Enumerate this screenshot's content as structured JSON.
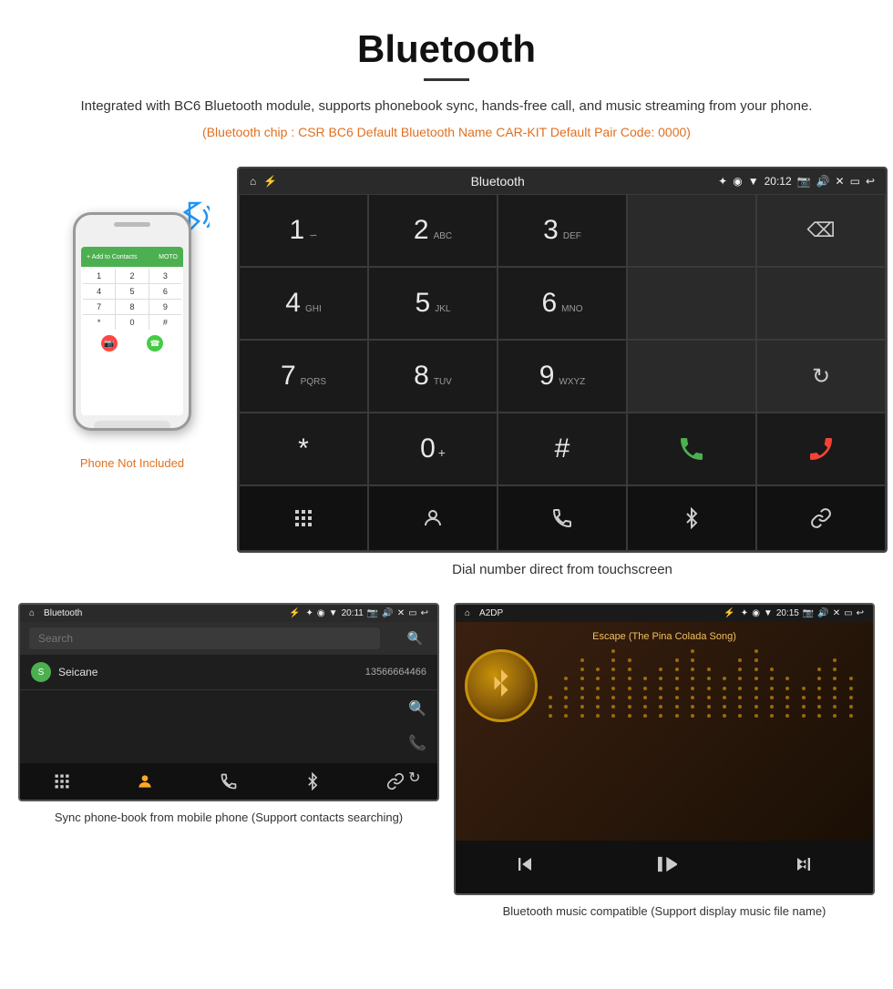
{
  "header": {
    "title": "Bluetooth",
    "description": "Integrated with BC6 Bluetooth module, supports phonebook sync, hands-free call, and music streaming from your phone.",
    "specs": "(Bluetooth chip : CSR BC6    Default Bluetooth Name CAR-KIT    Default Pair Code: 0000)"
  },
  "dial_screen": {
    "status_bar": {
      "title": "Bluetooth",
      "time": "20:12"
    },
    "keys": [
      {
        "num": "1",
        "sub": ""
      },
      {
        "num": "2",
        "sub": "ABC"
      },
      {
        "num": "3",
        "sub": "DEF"
      },
      {
        "num": "",
        "sub": ""
      },
      {
        "num": "⌫",
        "sub": ""
      },
      {
        "num": "4",
        "sub": "GHI"
      },
      {
        "num": "5",
        "sub": "JKL"
      },
      {
        "num": "6",
        "sub": "MNO"
      },
      {
        "num": "",
        "sub": ""
      },
      {
        "num": "",
        "sub": ""
      },
      {
        "num": "7",
        "sub": "PQRS"
      },
      {
        "num": "8",
        "sub": "TUV"
      },
      {
        "num": "9",
        "sub": "WXYZ"
      },
      {
        "num": "",
        "sub": ""
      },
      {
        "num": "↻",
        "sub": ""
      },
      {
        "num": "*",
        "sub": ""
      },
      {
        "num": "0+",
        "sub": ""
      },
      {
        "num": "#",
        "sub": ""
      },
      {
        "num": "📞",
        "sub": ""
      },
      {
        "num": "📵",
        "sub": ""
      }
    ],
    "bottom_icons": [
      "⊞",
      "👤",
      "📞",
      "✦",
      "🔗"
    ]
  },
  "dial_caption": "Dial number direct from touchscreen",
  "phone_label": "Phone Not Included",
  "contacts_screen": {
    "status_bar_title": "Bluetooth",
    "time": "20:11",
    "search_placeholder": "Search",
    "contacts": [
      {
        "initial": "S",
        "name": "Seicane",
        "number": "13566664466"
      }
    ],
    "bottom_icons": [
      "⊞",
      "👤",
      "📞",
      "✦",
      "🔗"
    ]
  },
  "contacts_caption": "Sync phone-book from mobile phone\n(Support contacts searching)",
  "music_screen": {
    "status_bar_title": "A2DP",
    "time": "20:15",
    "song_title": "Escape (The Pina Colada Song)",
    "controls": [
      "⏮",
      "⏯",
      "⏭"
    ]
  },
  "music_caption": "Bluetooth music compatible\n(Support display music file name)"
}
